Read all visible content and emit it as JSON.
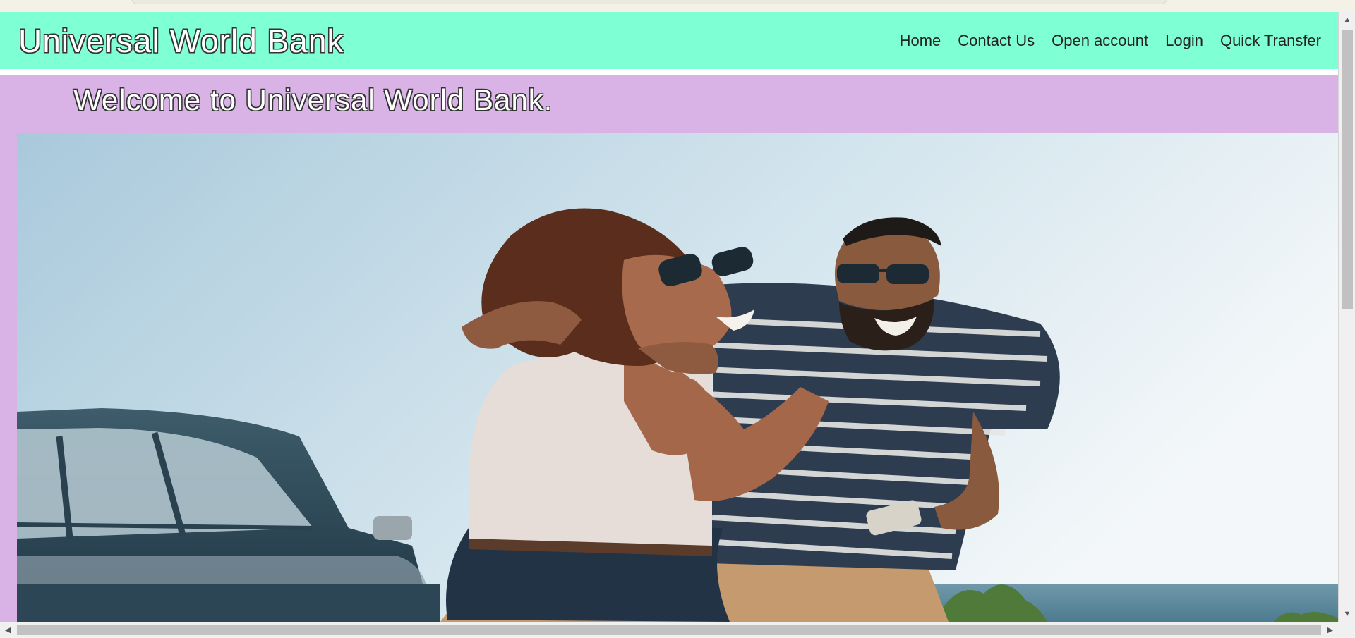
{
  "navbar": {
    "logo": "Universal World Bank",
    "links": [
      {
        "label": "Home"
      },
      {
        "label": "Contact Us"
      },
      {
        "label": "Open account"
      },
      {
        "label": "Login"
      },
      {
        "label": "Quick Transfer"
      }
    ]
  },
  "hero": {
    "welcome": "Welcome to Universal World Bank."
  },
  "colors": {
    "navbar_bg": "#7fffd4",
    "panel_bg": "#d9b3e6"
  }
}
